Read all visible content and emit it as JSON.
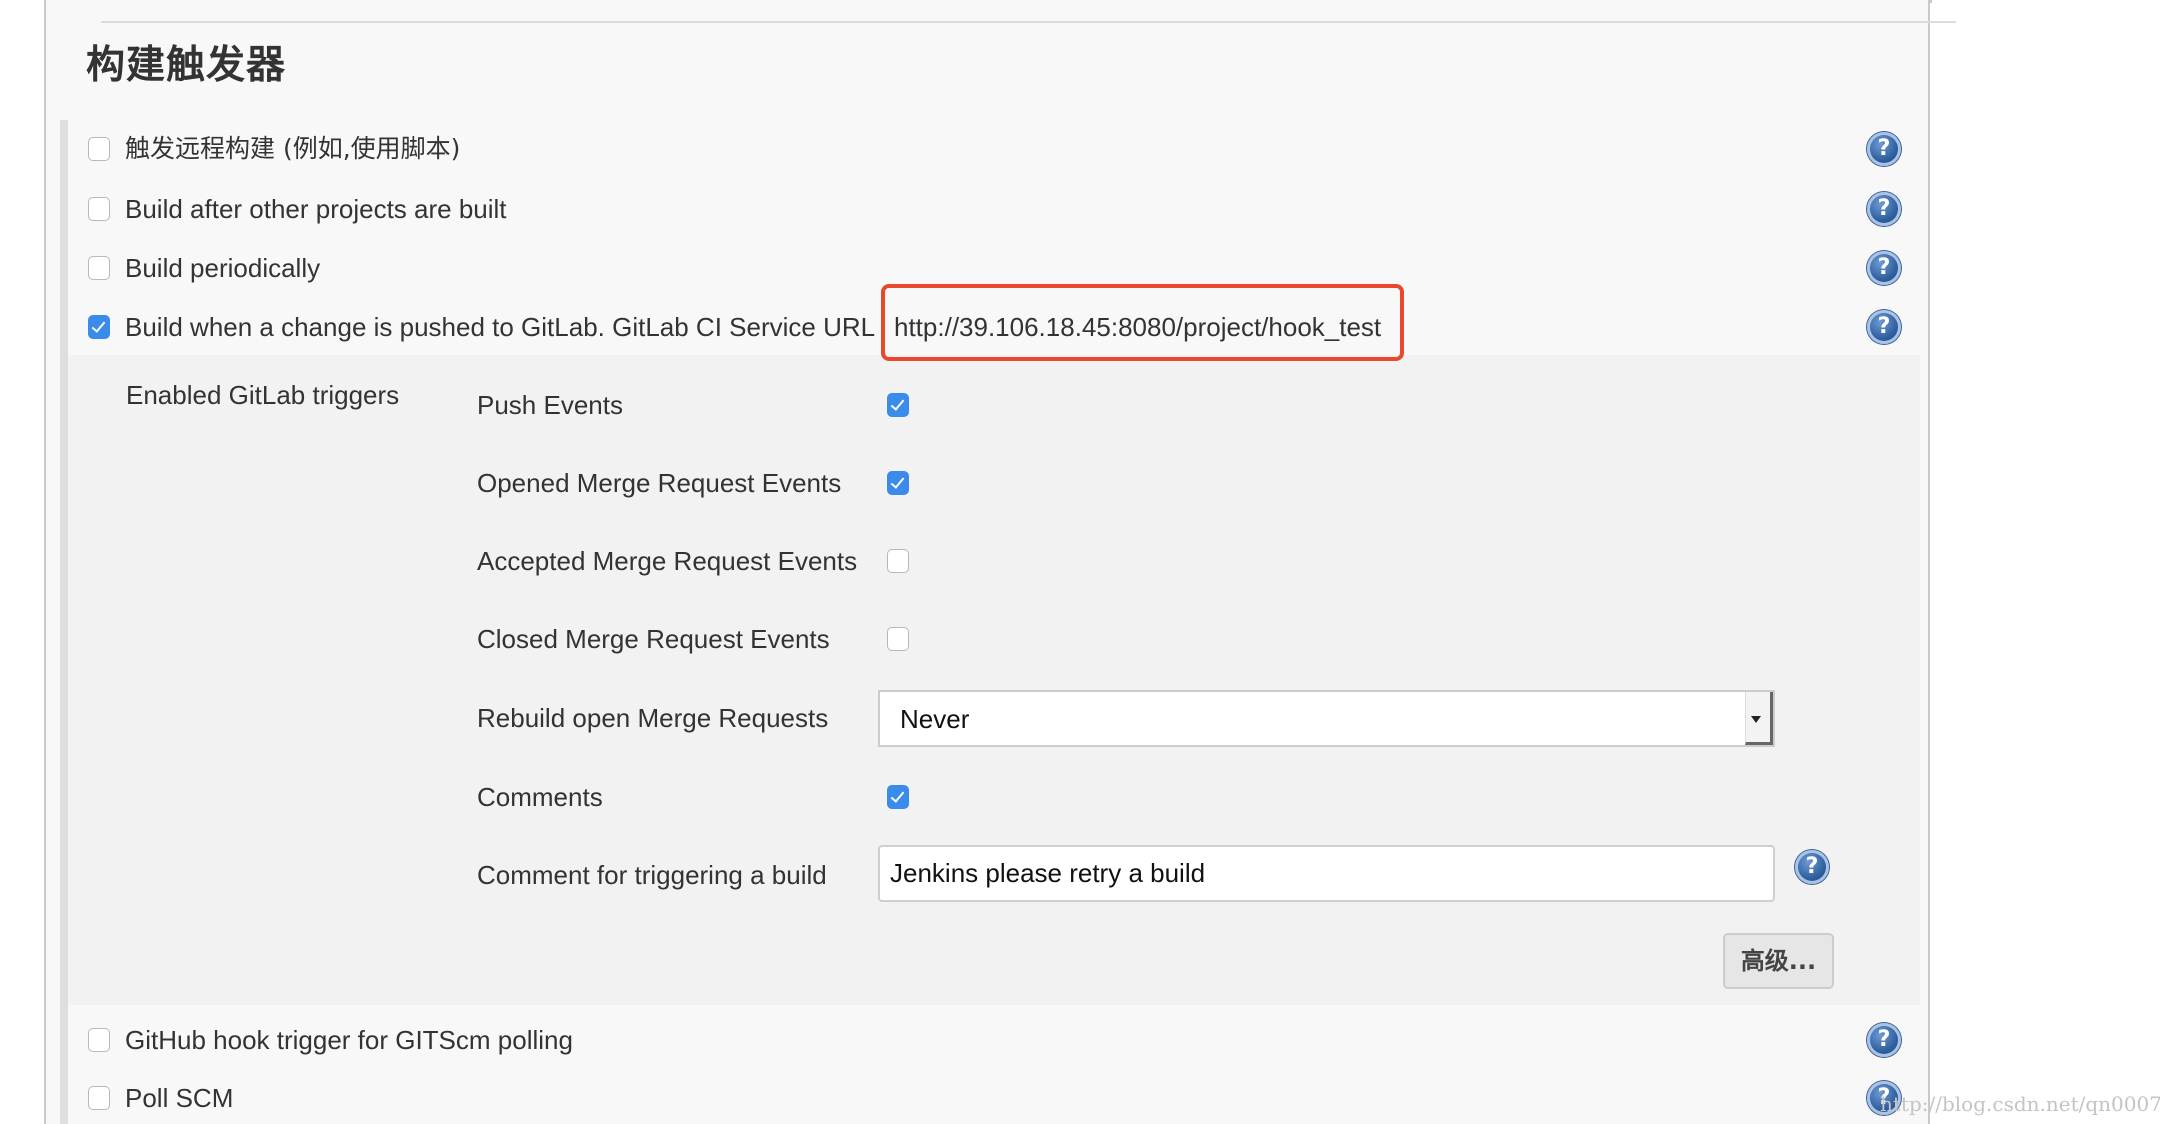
{
  "section": {
    "title": "构建触发器"
  },
  "triggers": [
    {
      "label": "触发远程构建 (例如,使用脚本)",
      "checked": false
    },
    {
      "label": "Build after other projects are built",
      "checked": false
    },
    {
      "label": "Build periodically",
      "checked": false
    },
    {
      "label": "Build when a change is pushed to GitLab. GitLab CI Service URL",
      "checked": true,
      "url": "http://39.106.18.45:8080/project/hook_test"
    },
    {
      "label": "GitHub hook trigger for GITScm polling",
      "checked": false
    },
    {
      "label": "Poll SCM",
      "checked": false
    }
  ],
  "gitlab": {
    "group_label": "Enabled GitLab triggers",
    "options": [
      {
        "label": "Push Events",
        "checked": true
      },
      {
        "label": "Opened Merge Request Events",
        "checked": true
      },
      {
        "label": "Accepted Merge Request Events",
        "checked": false
      },
      {
        "label": "Closed Merge Request Events",
        "checked": false
      }
    ],
    "rebuild": {
      "label": "Rebuild open Merge Requests",
      "value": "Never"
    },
    "comments": {
      "label": "Comments",
      "checked": true
    },
    "comment_trigger": {
      "label": "Comment for triggering a build",
      "value": "Jenkins please retry a build"
    },
    "advanced_button": "高级..."
  },
  "icons": {
    "help": "?"
  },
  "highlight_color": "#e8482b",
  "accent_color": "#3b8beb",
  "watermark": "http://blog.csdn.net/qn0007"
}
